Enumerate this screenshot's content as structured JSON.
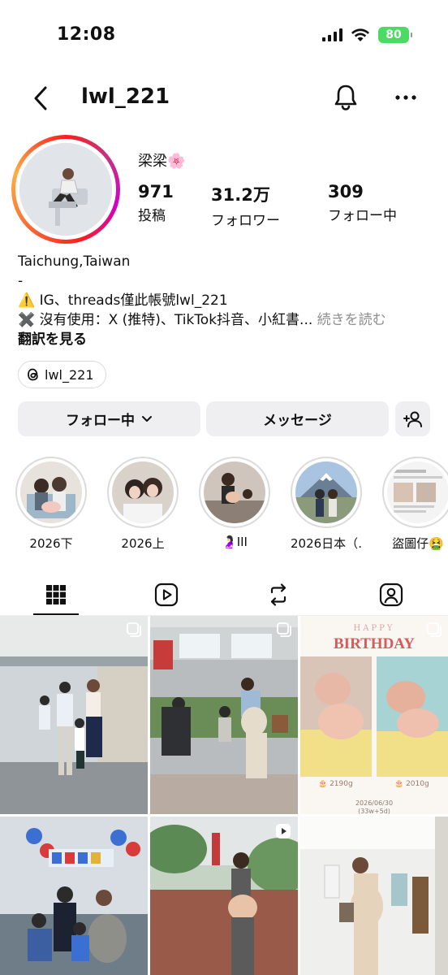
{
  "status_bar": {
    "time": "12:08",
    "battery": "80"
  },
  "header": {
    "username": "lwl_221"
  },
  "profile": {
    "display_name": "梁梁🌸",
    "stats": [
      {
        "value": "971",
        "label": "投稿"
      },
      {
        "value": "31.2万",
        "label": "フォロワー"
      },
      {
        "value": "309",
        "label": "フォロー中"
      }
    ],
    "bio": {
      "line1": "Taichung,Taiwan",
      "line2": "-",
      "line3": "⚠️ IG、threads僅此帳號lwl_221",
      "line4": "✖️ 沒有使用：X (推特)、TikTok抖音、小紅書...",
      "more": " 続きを読む",
      "translate": "翻訳を見る"
    },
    "threads_handle": "lwl_221"
  },
  "actions": {
    "following": "フォロー中",
    "message": "メッセージ"
  },
  "highlights": [
    {
      "label": "2026下"
    },
    {
      "label": "2026上"
    },
    {
      "label": "🤰🏻III"
    },
    {
      "label": "2026日本（…"
    },
    {
      "label": "盜圖仔🤮"
    }
  ],
  "posts": [
    {
      "type": "multi"
    },
    {
      "type": "multi"
    },
    {
      "type": "multi",
      "header_small": "HAPPY",
      "header": "BIRTHDAY",
      "caption_left": "🎂 2190g",
      "caption_right": "🎂 2010g",
      "date": "2026/06/30",
      "date_sub": "(33w+5d)"
    },
    {
      "type": "photo"
    },
    {
      "type": "reel"
    },
    {
      "type": "photo"
    }
  ],
  "colors": {
    "battery": "#4cd964",
    "text": "#111111",
    "muted": "#8e8e8e",
    "button_bg": "#efeff1",
    "birthday_red": "#d85a5a"
  }
}
